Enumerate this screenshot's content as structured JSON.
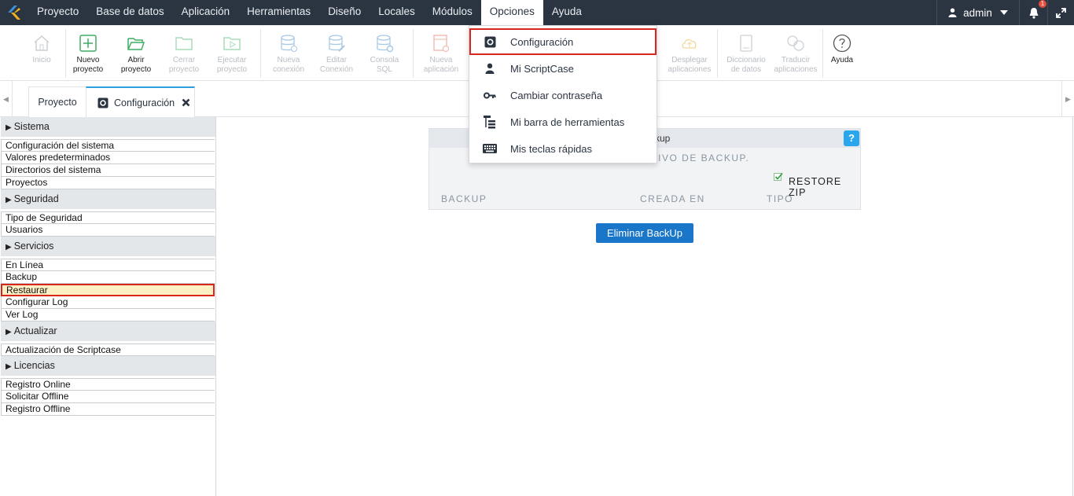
{
  "menubar": {
    "items": [
      "Proyecto",
      "Base de datos",
      "Aplicación",
      "Herramientas",
      "Diseño",
      "Locales",
      "Módulos",
      "Opciones",
      "Ayuda"
    ],
    "active": "Opciones",
    "user": "admin",
    "notifications": "1"
  },
  "toolbar": {
    "inicio": "Inicio",
    "nuevo1": "Nuevo",
    "nuevo2": "proyecto",
    "abrir1": "Abrir",
    "abrir2": "proyecto",
    "cerrar1": "Cerrar",
    "cerrar2": "proyecto",
    "ejecutar1": "Ejecutar",
    "ejecutar2": "proyecto",
    "nconex1": "Nueva",
    "nconex2": "conexión",
    "econex1": "Editar",
    "econex2": "Conexión",
    "consola1": "Consola",
    "consola2": "SQL",
    "napp1": "Nueva",
    "napp2": "aplicación",
    "partial": "o",
    "desplegar1": "Desplegar",
    "desplegar2": "aplicaciones",
    "dicc1": "Diccionario",
    "dicc2": "de datos",
    "traducir1": "Traducir",
    "traducir2": "aplicaciones",
    "ayuda": "Ayuda"
  },
  "tabs": {
    "proyecto": "Proyecto",
    "configuracion": "Configuración"
  },
  "sidebar": {
    "sistema": "Sistema",
    "sistema_items": [
      "Configuración del sistema",
      "Valores predeterminados",
      "Directorios del sistema",
      "Proyectos"
    ],
    "seguridad": "Seguridad",
    "seguridad_items": [
      "Tipo de Seguridad",
      "Usuarios"
    ],
    "servicios": "Servicios",
    "servicios_items": [
      "En Línea",
      "Backup",
      "Restaurar",
      "Configurar Log",
      "Ver Log"
    ],
    "actualizar": "Actualizar",
    "actualizar_items": [
      "Actualización de Scriptcase"
    ],
    "licencias": "Licencias",
    "licencias_items": [
      "Registro Online",
      "Solicitar Offline",
      "Registro Offline"
    ]
  },
  "main": {
    "panel_title_partial": "ckup",
    "help": "?",
    "archivo_partial": "RIVO DE BACKUP.",
    "restore_zip": "RESTORE ZIP",
    "col_backup": "BACKUP",
    "col_creada": "CREADA EN",
    "col_tipo": "TIPO",
    "delete_button": "Eliminar BackUp"
  },
  "dropdown": {
    "items": [
      "Configuración",
      "Mi ScriptCase",
      "Cambiar contraseña",
      "Mi barra de herramientas",
      "Mis teclas rápidas"
    ]
  }
}
